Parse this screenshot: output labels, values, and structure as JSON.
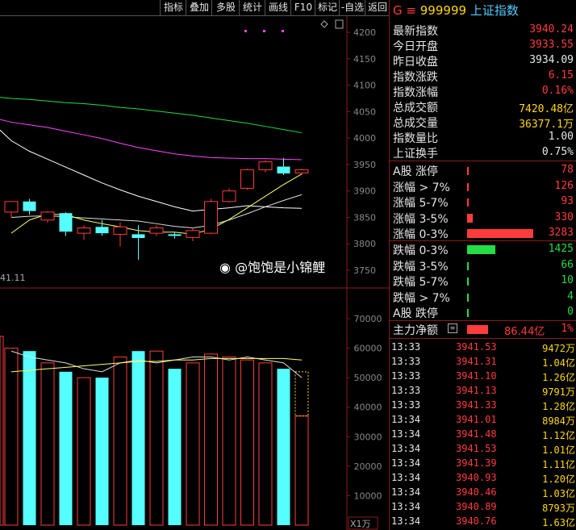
{
  "toolbar": {
    "items": [
      "指标",
      "叠加",
      "多股",
      "统计",
      "画线",
      "F10",
      "标记",
      "-自选",
      "返回"
    ]
  },
  "chart": {
    "price_ticks": [
      "4200",
      "4150",
      "4100",
      "4050",
      "4000",
      "3950",
      "3900",
      "3850",
      "3800",
      "3750"
    ],
    "volume_ticks": [
      "70000",
      "60000",
      "50000",
      "40000",
      "30000",
      "20000",
      "10000"
    ],
    "date_label": "41.11",
    "volume_unit": "X1万",
    "watermark": "@饱饱是小锦鲤"
  },
  "chart_data": {
    "type": "candlestick",
    "price_ylim": [
      3750,
      4200
    ],
    "volume_ylim": [
      0,
      70000
    ],
    "candles": [
      {
        "o": 3860,
        "c": 3880,
        "h": 3880,
        "l": 3850
      },
      {
        "o": 3880,
        "c": 3862,
        "h": 3885,
        "l": 3855
      },
      {
        "o": 3845,
        "c": 3860,
        "h": 3862,
        "l": 3840
      },
      {
        "o": 3858,
        "c": 3823,
        "h": 3860,
        "l": 3815
      },
      {
        "o": 3820,
        "c": 3830,
        "h": 3835,
        "l": 3808
      },
      {
        "o": 3832,
        "c": 3820,
        "h": 3845,
        "l": 3815
      },
      {
        "o": 3818,
        "c": 3832,
        "h": 3840,
        "l": 3795
      },
      {
        "o": 3818,
        "c": 3811,
        "h": 3835,
        "l": 3770
      },
      {
        "o": 3820,
        "c": 3830,
        "h": 3835,
        "l": 3815
      },
      {
        "o": 3818,
        "c": 3815,
        "h": 3822,
        "l": 3810
      },
      {
        "o": 3812,
        "c": 3825,
        "h": 3830,
        "l": 3805
      },
      {
        "o": 3820,
        "c": 3880,
        "h": 3885,
        "l": 3818
      },
      {
        "o": 3880,
        "c": 3900,
        "h": 3905,
        "l": 3878
      },
      {
        "o": 3905,
        "c": 3940,
        "h": 3942,
        "l": 3902
      },
      {
        "o": 3940,
        "c": 3955,
        "h": 3958,
        "l": 3935
      },
      {
        "o": 3946,
        "c": 3933,
        "h": 3962,
        "l": 3930
      },
      {
        "o": 3934,
        "c": 3940,
        "h": 3942,
        "l": 3930
      }
    ],
    "volumes": [
      60000,
      59000,
      55000,
      52000,
      50000,
      50000,
      57000,
      59000,
      59000,
      53000,
      55000,
      58000,
      57000,
      56000,
      55000,
      53000,
      37000
    ],
    "last_volume_ghost": 52000,
    "ma5": [
      3820,
      3845,
      3856,
      3855,
      3845,
      3838,
      3832,
      3825,
      3822,
      3822,
      3818,
      3828,
      3846,
      3868,
      3890,
      3912,
      3932
    ],
    "ma10": [
      3850,
      3852,
      3853,
      3851,
      3849,
      3847,
      3845,
      3843,
      3838,
      3833,
      3830,
      3835,
      3845,
      3857,
      3870,
      3882,
      3893
    ],
    "ma20": [
      3995,
      3975,
      3960,
      3945,
      3930,
      3915,
      3902,
      3890,
      3880,
      3870,
      3862,
      3865,
      3868,
      3872,
      3870,
      3868,
      3867
    ],
    "ma60": [
      4030,
      4025,
      4020,
      4013,
      4006,
      3999,
      3990,
      3982,
      3976,
      3970,
      3966,
      3963,
      3962,
      3961,
      3961,
      3960,
      3959
    ],
    "ma120": [
      4075,
      4073,
      4070,
      4067,
      4065,
      4062,
      4058,
      4055,
      4051,
      4047,
      4043,
      4038,
      4033,
      4028,
      4022,
      4016,
      4010
    ],
    "vol_ma5": [
      59000,
      57000,
      56000,
      55000,
      53000,
      52000,
      55000,
      56000,
      55000,
      56000,
      57000,
      57000,
      56000,
      57000,
      56000,
      55000,
      50000
    ],
    "vol_ma10": [
      52000,
      52500,
      53000,
      53500,
      54000,
      54500,
      55000,
      55500,
      55500,
      56000,
      56000,
      56500,
      56500,
      56500,
      56500,
      56500,
      56000
    ]
  },
  "quote": {
    "prefix": "G",
    "code": "999999",
    "name": "上证指数",
    "rows": [
      {
        "label": "最新指数",
        "value": "3940.24",
        "color": "red"
      },
      {
        "label": "今日开盘",
        "value": "3933.55",
        "color": "red"
      },
      {
        "label": "昨日收盘",
        "value": "3934.09",
        "color": "wht"
      },
      {
        "label": "指数涨跌",
        "value": "6.15",
        "color": "red"
      },
      {
        "label": "指数涨幅",
        "value": "0.16%",
        "color": "red"
      },
      {
        "label": "总成交额",
        "value": "7420.48亿",
        "color": "yel"
      },
      {
        "label": "总成交量",
        "value": "36377.1万",
        "color": "yel"
      },
      {
        "label": "指数量比",
        "value": "1.00",
        "color": "wht"
      },
      {
        "label": "上证换手",
        "value": "0.75%",
        "color": "wht"
      }
    ]
  },
  "breadth": {
    "up": [
      {
        "label": "A股 涨停",
        "value": "78",
        "bar": 0.02
      },
      {
        "label": "涨幅 > 7%",
        "value": "126",
        "bar": 0.03
      },
      {
        "label": "涨幅 5-7%",
        "value": "93",
        "bar": 0.025
      },
      {
        "label": "涨幅 3-5%",
        "value": "330",
        "bar": 0.09
      },
      {
        "label": "涨幅 0-3%",
        "value": "3283",
        "bar": 1.0
      }
    ],
    "down": [
      {
        "label": "跌幅 0-3%",
        "value": "1425",
        "bar": 0.43
      },
      {
        "label": "跌幅 3-5%",
        "value": "66",
        "bar": 0.02
      },
      {
        "label": "跌幅 5-7%",
        "value": "10",
        "bar": 0.01
      },
      {
        "label": "跌幅 > 7%",
        "value": "4",
        "bar": 0.005
      },
      {
        "label": "A股 跌停",
        "value": "0",
        "bar": 0.005
      }
    ]
  },
  "netflow": {
    "label": "主力净额",
    "value": "86.44亿",
    "percent": "1%"
  },
  "ticks": [
    {
      "time": "13:33",
      "price": "3941.53",
      "vol": "9472万"
    },
    {
      "time": "13:33",
      "price": "3941.31",
      "vol": "1.04亿"
    },
    {
      "time": "13:33",
      "price": "3941.10",
      "vol": "1.26亿"
    },
    {
      "time": "13:33",
      "price": "3941.13",
      "vol": "9791万"
    },
    {
      "time": "13:33",
      "price": "3941.33",
      "vol": "1.28亿"
    },
    {
      "time": "13:34",
      "price": "3941.01",
      "vol": "8984万"
    },
    {
      "time": "13:34",
      "price": "3941.48",
      "vol": "1.12亿"
    },
    {
      "time": "13:34",
      "price": "3941.53",
      "vol": "1.01亿"
    },
    {
      "time": "13:34",
      "price": "3941.39",
      "vol": "1.11亿"
    },
    {
      "time": "13:34",
      "price": "3940.93",
      "vol": "1.20亿"
    },
    {
      "time": "13:34",
      "price": "3940.46",
      "vol": "1.03亿"
    },
    {
      "time": "13:34",
      "price": "3940.89",
      "vol": "8793万"
    },
    {
      "time": "13:34",
      "price": "3940.76",
      "vol": "1.63亿"
    }
  ],
  "colors": {
    "up": "#ff3b3b",
    "down": "#55ffff",
    "ma5": "#ffffff",
    "ma10": "#ffff66",
    "ma20": "#ff44ff",
    "ma60": "#22dd44",
    "grid": "#8b1a1a"
  }
}
